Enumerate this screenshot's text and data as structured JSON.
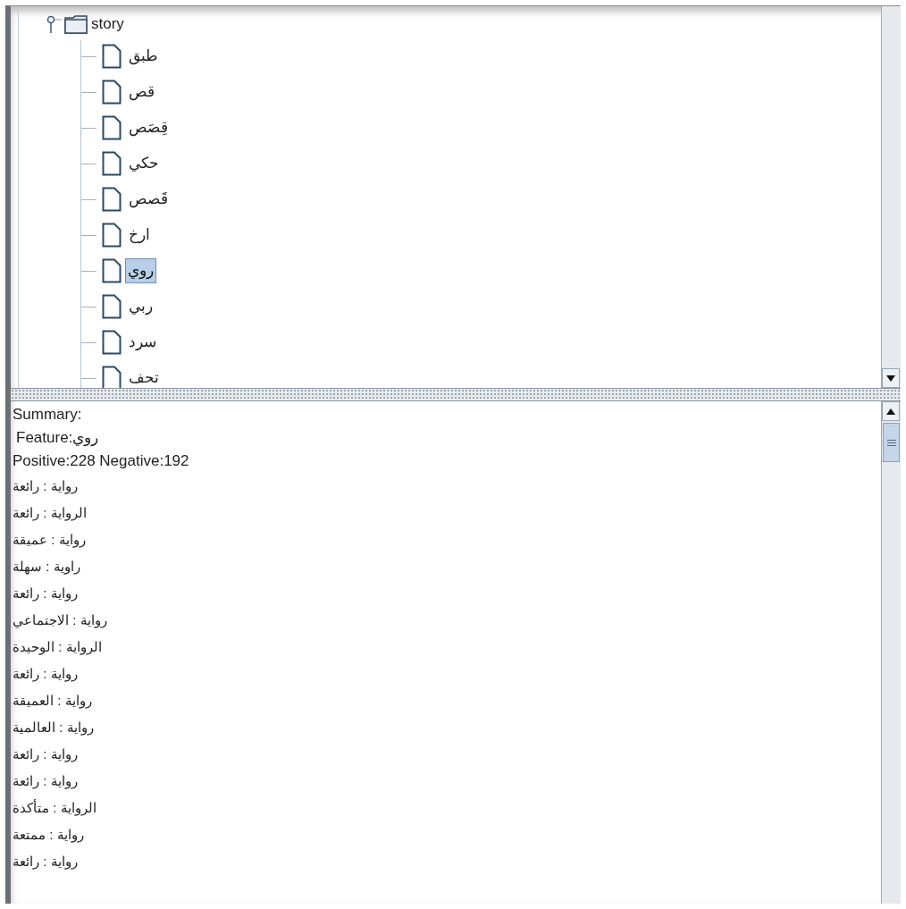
{
  "tree": {
    "root": {
      "label": "story",
      "expanded": true
    },
    "children": [
      {
        "label": "طبق",
        "selected": false
      },
      {
        "label": "قص",
        "selected": false
      },
      {
        "label": "قِصَص",
        "selected": false
      },
      {
        "label": "حكي",
        "selected": false
      },
      {
        "label": "قَصص",
        "selected": false
      },
      {
        "label": "ارخ",
        "selected": false
      },
      {
        "label": "روي",
        "selected": true
      },
      {
        "label": "ربي",
        "selected": false
      },
      {
        "label": "سرد",
        "selected": false
      },
      {
        "label": "تحف",
        "selected": false
      }
    ]
  },
  "summary": {
    "title": "Summary:",
    "feature": "Feature:روي",
    "counts": "Positive:228  Negative:192",
    "lines": [
      "رواية : رائعة",
      "الرواية : رائعة",
      "رواية : عميقة",
      "راوية : سهلة",
      "رواية : رائعة",
      "رواية : الاجتماعي",
      "الرواية : الوحيدة",
      "رواية : رائعة",
      "رواية : العميقة",
      "رواية : العالمية",
      "رواية : رائعة",
      "رواية : رائعة",
      "الرواية : متأكدة",
      "رواية : ممتعة",
      "رواية : رائعة"
    ]
  }
}
